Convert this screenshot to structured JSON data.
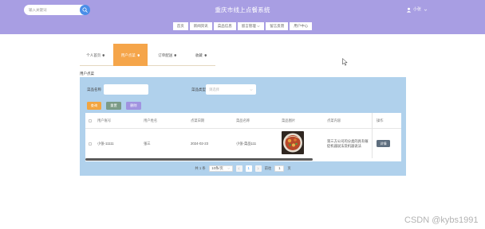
{
  "header": {
    "search_placeholder": "输入关键词",
    "title": "重庆市线上点餐系统",
    "username": "小张"
  },
  "nav": [
    {
      "label": "首页"
    },
    {
      "label": "新闻资讯"
    },
    {
      "label": "菜品信息"
    },
    {
      "label": "留言管理",
      "has_dropdown": true
    },
    {
      "label": "留言反馈"
    },
    {
      "label": "用户中心"
    }
  ],
  "tabs": [
    {
      "label": "个人首页",
      "active": false
    },
    {
      "label": "用户点菜",
      "active": true
    },
    {
      "label": "订单配送",
      "active": false
    },
    {
      "label": "收藏",
      "active": false
    }
  ],
  "section_title": "用户点菜",
  "filters": {
    "name_label": "菜品名称",
    "type_label": "菜品类型",
    "type_placeholder": "请选择"
  },
  "buttons": {
    "query": "查询",
    "reset": "重置",
    "delete": "删除"
  },
  "table": {
    "columns": [
      "用户账号",
      "用户姓名",
      "点菜日期",
      "菜品名称",
      "菜品图片",
      "点菜内容",
      "操作"
    ],
    "rows": [
      {
        "account": "小张-11111",
        "name": "张三",
        "date": "2024-02-23",
        "dish": "小张-菜品111",
        "content": "第三方公司的分类的具有催促机器说法及机器说法",
        "action": "详情"
      }
    ]
  },
  "pagination": {
    "total": "共 1 条",
    "page_size": "10条/页",
    "current": "1",
    "goto_label": "前往",
    "goto_value": "1",
    "page_suffix": "页"
  },
  "watermark": "CSDN @kybs1991",
  "icons": [
    "search-icon",
    "user-avatar-icon",
    "chevron-down-icon",
    "pin-icon",
    "chevron-left-icon",
    "chevron-right-icon",
    "mouse-cursor-icon"
  ],
  "colors": {
    "header": "#a89ee3",
    "search_button": "#4a8ee8",
    "active_tab": "#f5a54a",
    "panel": "#b0d1ec",
    "query_button": "#f2a541",
    "reset_button": "#7b9b87",
    "delete_button": "#a193e0",
    "detail_button": "#5e6e7e"
  }
}
